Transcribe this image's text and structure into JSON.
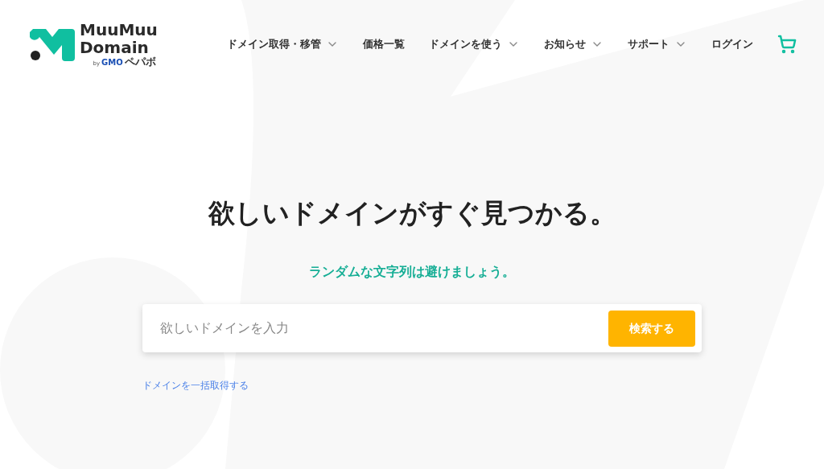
{
  "logo": {
    "line1": "MuuMuu",
    "line2": "Domain",
    "by": "by",
    "brand": "GMO",
    "brand_suffix": "ペパボ"
  },
  "nav": [
    {
      "label": "ドメイン取得・移管",
      "has_dropdown": true
    },
    {
      "label": "価格一覧",
      "has_dropdown": false
    },
    {
      "label": "ドメインを使う",
      "has_dropdown": true
    },
    {
      "label": "お知らせ",
      "has_dropdown": true
    },
    {
      "label": "サポート",
      "has_dropdown": true
    },
    {
      "label": "ログイン",
      "has_dropdown": false
    }
  ],
  "hero": {
    "title": "欲しいドメインがすぐ見つかる。",
    "subtitle": "ランダムな文字列は避けましょう。"
  },
  "search": {
    "placeholder": "欲しいドメインを入力",
    "button": "検索する"
  },
  "bulk_link": "ドメインを一括取得する"
}
